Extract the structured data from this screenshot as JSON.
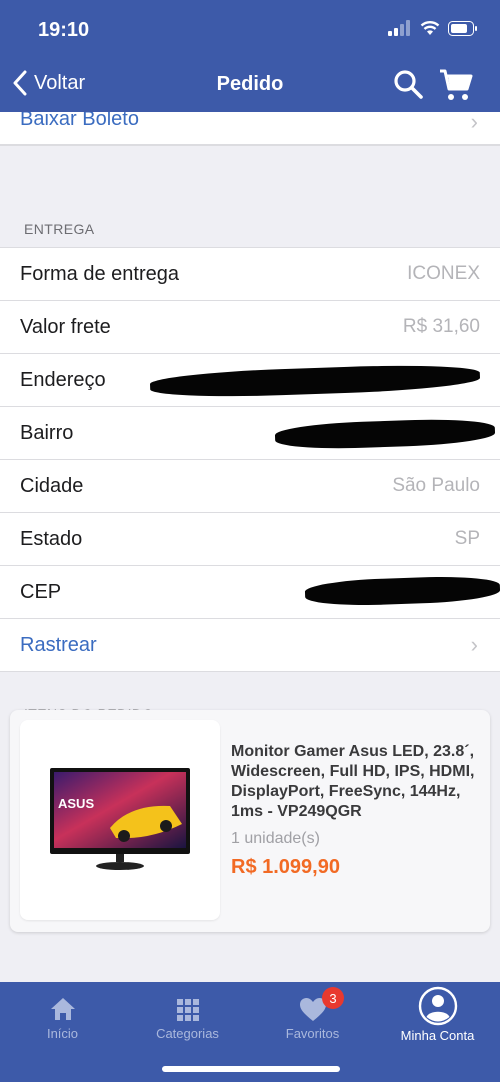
{
  "status_bar": {
    "time": "19:10"
  },
  "nav": {
    "back_label": "Voltar",
    "title": "Pedido",
    "search_icon": "search-icon",
    "cart_icon": "cart-icon"
  },
  "boleto": {
    "label": "Baixar Boleto"
  },
  "entrega": {
    "title": "ENTREGA",
    "rows": [
      {
        "label": "Forma de entrega",
        "value": "ICONEX"
      },
      {
        "label": "Valor frete",
        "value": "R$ 31,60"
      },
      {
        "label": "Endereço",
        "value": ""
      },
      {
        "label": "Bairro",
        "value": ""
      },
      {
        "label": "Cidade",
        "value": "São Paulo"
      },
      {
        "label": "Estado",
        "value": "SP"
      },
      {
        "label": "CEP",
        "value": ""
      }
    ],
    "track_label": "Rastrear"
  },
  "itens": {
    "title": "ITENS DO PEDIDO",
    "items": [
      {
        "name": "Monitor Gamer Asus LED, 23.8´, Widescreen, Full HD, IPS, HDMI, DisplayPort, FreeSync, 144Hz, 1ms - VP249QGR",
        "quantity": "1 unidade(s)",
        "price": "R$ 1.099,90",
        "image_brand": "ASUS"
      }
    ]
  },
  "tabbar": {
    "tabs": [
      {
        "label": "Início",
        "icon": "home-icon"
      },
      {
        "label": "Categorias",
        "icon": "grid-icon"
      },
      {
        "label": "Favoritos",
        "icon": "heart-icon",
        "badge": "3"
      },
      {
        "label": "Minha Conta",
        "icon": "user-icon"
      }
    ],
    "active": "Minha Conta"
  },
  "colors": {
    "brand": "#3d5aa9",
    "link": "#3b6cc0",
    "price": "#f26a24",
    "badge": "#e8392f"
  }
}
